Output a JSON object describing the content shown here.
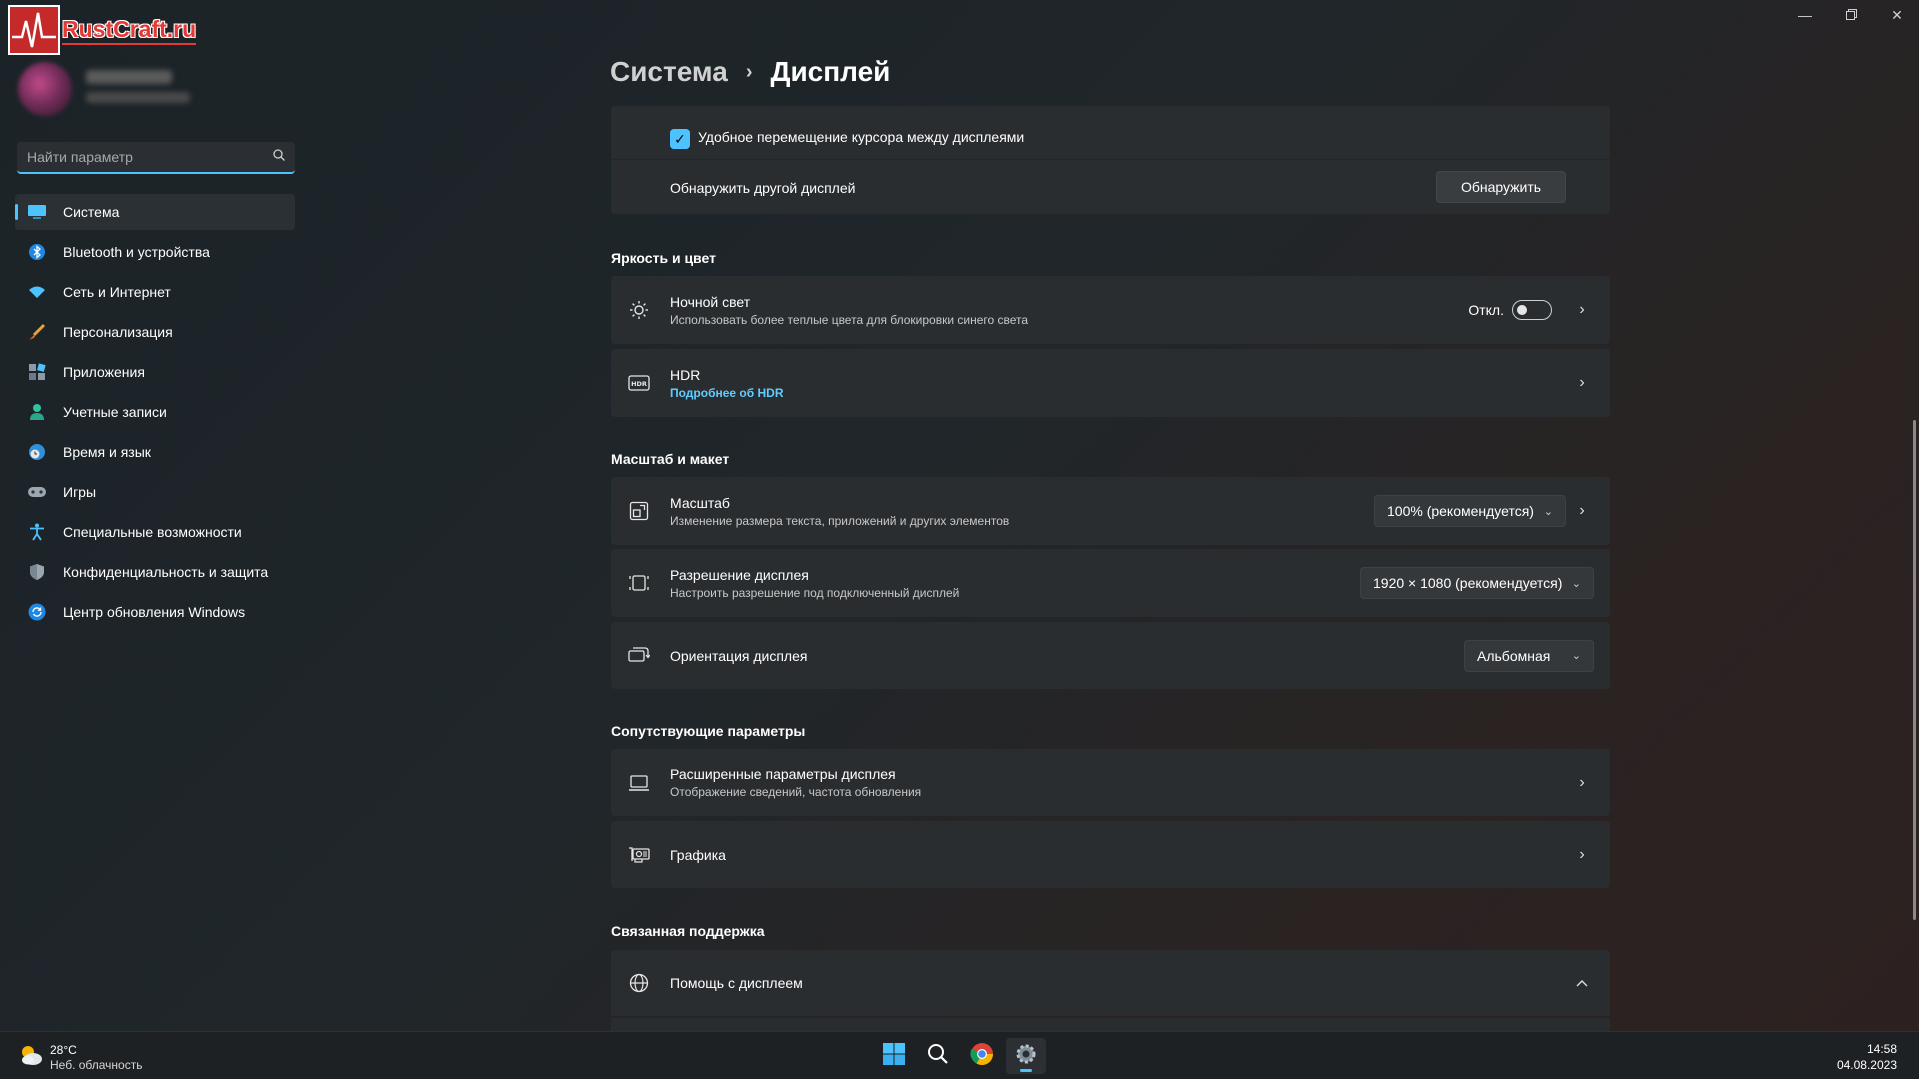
{
  "watermark": {
    "text": "RustCraft.ru"
  },
  "window": {
    "minimize_icon": "minimize-icon",
    "restore_icon": "restore-icon",
    "close_icon": "close-icon"
  },
  "search": {
    "placeholder": "Найти параметр"
  },
  "sidebar": {
    "items": [
      {
        "label": "Система",
        "icon": "system-icon",
        "active": true
      },
      {
        "label": "Bluetooth и устройства",
        "icon": "bluetooth-icon"
      },
      {
        "label": "Сеть и Интернет",
        "icon": "wifi-icon"
      },
      {
        "label": "Персонализация",
        "icon": "brush-icon"
      },
      {
        "label": "Приложения",
        "icon": "apps-icon"
      },
      {
        "label": "Учетные записи",
        "icon": "user-icon"
      },
      {
        "label": "Время и язык",
        "icon": "globe-clock-icon"
      },
      {
        "label": "Игры",
        "icon": "gamepad-icon"
      },
      {
        "label": "Специальные возможности",
        "icon": "accessibility-icon"
      },
      {
        "label": "Конфиденциальность и защита",
        "icon": "shield-icon"
      },
      {
        "label": "Центр обновления Windows",
        "icon": "update-icon"
      }
    ]
  },
  "header": {
    "parent": "Система",
    "separator": "›",
    "current": "Дисплей"
  },
  "multi_display": {
    "cursor_move_label": "Удобное перемещение курсора между дисплеями",
    "cursor_move_checked": true,
    "detect_label": "Обнаружить другой дисплей",
    "detect_button": "Обнаружить"
  },
  "brightness": {
    "section_title": "Яркость и цвет",
    "night_light": {
      "title": "Ночной свет",
      "subtitle": "Использовать более теплые цвета для блокировки синего света",
      "state": "Откл.",
      "on": false
    },
    "hdr": {
      "title": "HDR",
      "link": "Подробнее об HDR"
    }
  },
  "scale_layout": {
    "section_title": "Масштаб и макет",
    "scale": {
      "title": "Масштаб",
      "subtitle": "Изменение размера текста, приложений и других элементов",
      "value": "100% (рекомендуется)"
    },
    "resolution": {
      "title": "Разрешение дисплея",
      "subtitle": "Настроить разрешение под подключенный дисплей",
      "value": "1920 × 1080 (рекомендуется)"
    },
    "orientation": {
      "title": "Ориентация дисплея",
      "value": "Альбомная"
    }
  },
  "related": {
    "section_title": "Сопутствующие параметры",
    "advanced": {
      "title": "Расширенные параметры дисплея",
      "subtitle": "Отображение сведений, частота обновления"
    },
    "graphics": {
      "title": "Графика"
    }
  },
  "support": {
    "section_title": "Связанная поддержка",
    "help": {
      "title": "Помощь с дисплеем"
    }
  },
  "taskbar": {
    "weather_temp": "28°C",
    "weather_desc": "Неб. облачность",
    "time": "14:58",
    "date": "04.08.2023",
    "apps": [
      "start-icon",
      "search-icon",
      "chrome-icon",
      "settings-icon"
    ]
  },
  "colors": {
    "accent": "#4cc2ff",
    "link": "#60cdff",
    "card": "#2a2d30",
    "watermark_red": "#e53935"
  }
}
